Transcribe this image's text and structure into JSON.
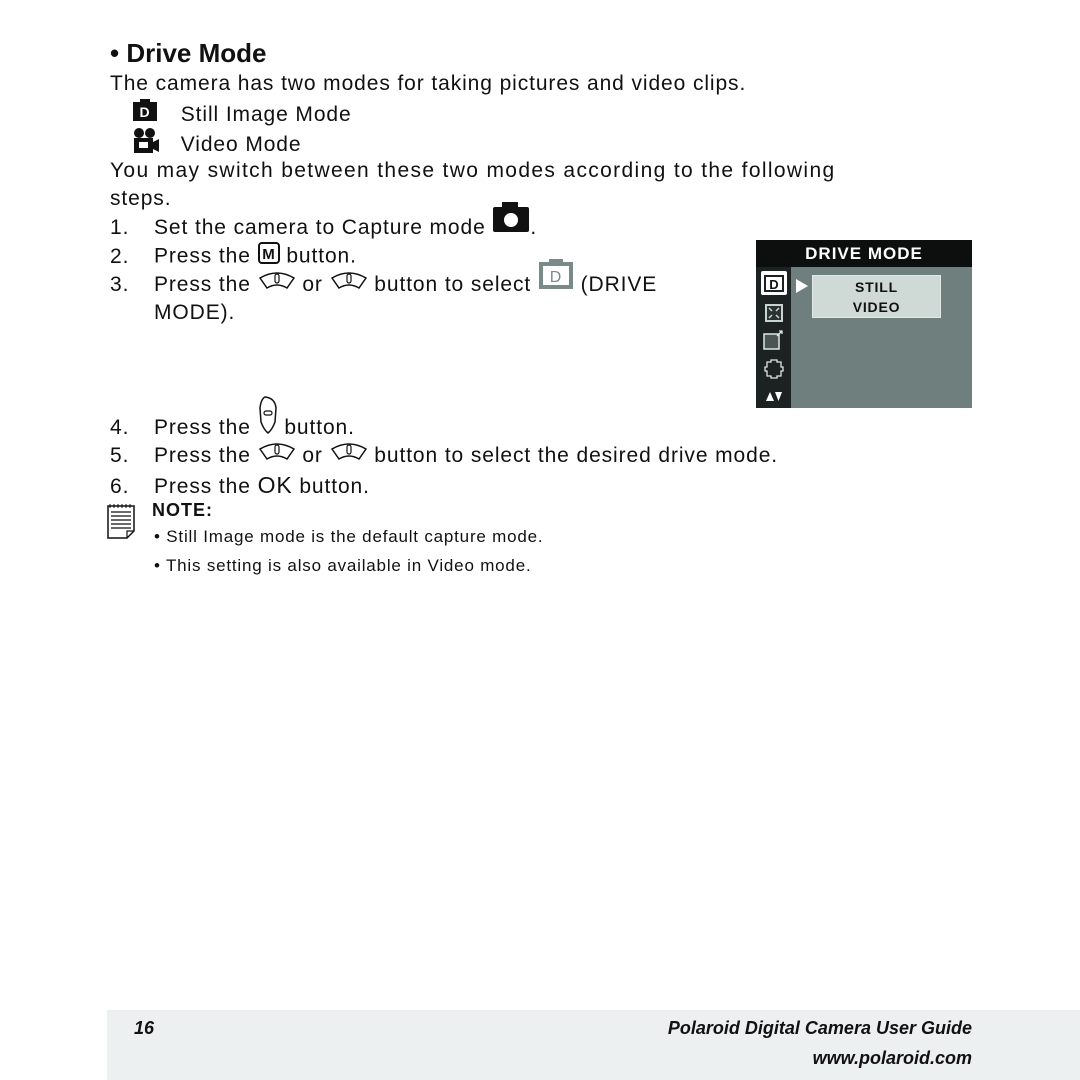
{
  "section": {
    "bullet": "•",
    "title": "Drive Mode"
  },
  "intro": "The camera has two modes for taking pictures and video clips.",
  "modes": [
    {
      "icon": "still-image-mode-icon",
      "label": "Still Image Mode"
    },
    {
      "icon": "video-mode-icon",
      "label": "Video Mode"
    }
  ],
  "switch_text_line1": "You may switch between these two modes according to the following",
  "switch_text_line2": "steps.",
  "steps": [
    {
      "num": "1.",
      "pre": "Set the camera to Capture mode",
      "post": "."
    },
    {
      "num": "2.",
      "pre": "Press the",
      "post": "button."
    },
    {
      "num": "3.",
      "pre": "Press the",
      "mid1": "or",
      "mid2": "button to select",
      "post": "(DRIVE",
      "cont": "MODE)."
    },
    {
      "num": "4.",
      "pre": "Press the",
      "post": "button."
    },
    {
      "num": "5.",
      "pre": "Press the",
      "mid1": "or",
      "post": "button to select the desired drive mode."
    },
    {
      "num": "6.",
      "pre": "Press the",
      "ok": "OK",
      "post": "button."
    }
  ],
  "note": {
    "label": "NOTE:",
    "items": [
      "Still Image mode is the default capture mode.",
      "This setting is also available in Video mode."
    ]
  },
  "drive_mode_screen": {
    "title": "DRIVE MODE",
    "options": [
      "STILL",
      "VIDEO"
    ],
    "selected": "STILL",
    "side_icons": [
      "drive-mode-icon",
      "focus-icon",
      "exposure-icon",
      "resolution-icon",
      "up-down-arrows-icon"
    ]
  },
  "footer": {
    "page_number": "16",
    "guide_title": "Polaroid Digital Camera User Guide",
    "url": "www.polaroid.com"
  }
}
